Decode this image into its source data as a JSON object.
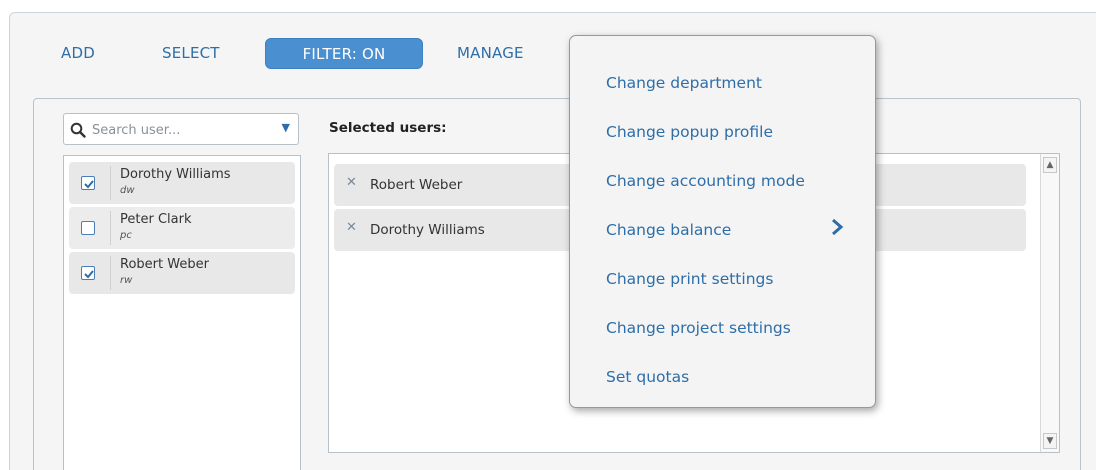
{
  "toolbar": {
    "add_label": "ADD",
    "select_label": "SELECT",
    "filter_label": "FILTER: ON",
    "manage_label": "MANAGE"
  },
  "search": {
    "placeholder": "Search user...",
    "value": ""
  },
  "user_list": {
    "items": [
      {
        "name": "Dorothy Williams",
        "id": "dw",
        "checked": true
      },
      {
        "name": "Peter Clark",
        "id": "pc",
        "checked": false
      },
      {
        "name": "Robert Weber",
        "id": "rw",
        "checked": true
      }
    ]
  },
  "selected": {
    "title": "Selected users:",
    "items": [
      {
        "name": "Robert Weber"
      },
      {
        "name": "Dorothy Williams"
      }
    ]
  },
  "manage_menu": {
    "items": [
      {
        "label": "Change department"
      },
      {
        "label": "Change popup profile"
      },
      {
        "label": "Change accounting mode"
      },
      {
        "label": "Change balance",
        "has_submenu": true
      },
      {
        "label": "Change print settings"
      },
      {
        "label": "Change project settings"
      },
      {
        "label": "Set quotas"
      }
    ]
  },
  "colors": {
    "accent": "#2e6ea8",
    "filter_active_bg": "#4a8fd0",
    "panel_bg": "#f5f5f5",
    "row_bg": "#e8e8e8"
  },
  "icons": {
    "search": "search-icon",
    "dropdown": "caret-down-icon",
    "checkbox": "checkbox-icon",
    "remove": "close-icon",
    "submenu": "chevron-right-icon",
    "scroll_up": "chevron-up-icon",
    "scroll_down": "chevron-down-icon"
  }
}
